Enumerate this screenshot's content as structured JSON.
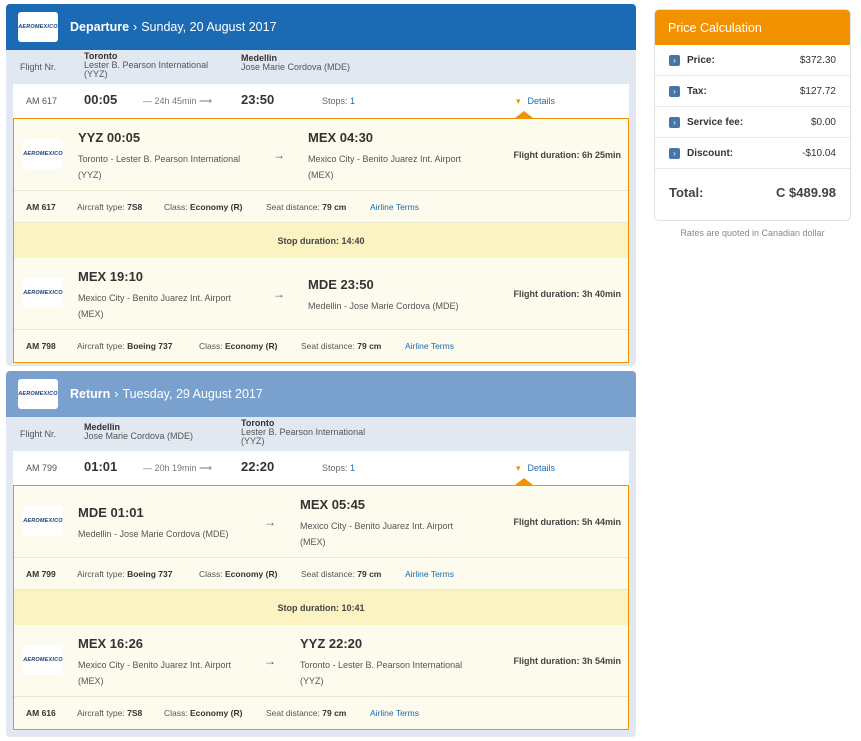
{
  "airline_logo_text": "AEROMEXICO",
  "colors": {
    "departure_header": "#1a6bb3",
    "return_header": "#7aa1cd",
    "accent": "#f29200",
    "link": "#1a6bb3",
    "stop_bar": "#fcf3c3"
  },
  "departure": {
    "header": {
      "label": "Departure",
      "sep": "›",
      "date": "Sunday, 20 August 2017"
    },
    "route": {
      "flight_nr_label": "Flight Nr.",
      "from_city": "Toronto",
      "from_airport": "Lester B. Pearson International",
      "from_code": "(YYZ)",
      "to_city": "Medellin",
      "to_airport": "Jose Marie Cordova (MDE)"
    },
    "summary": {
      "flight": "AM 617",
      "dep_time": "00:05",
      "duration": "— 24h 45min ⟶",
      "arr_time": "23:50",
      "stops_label": "Stops:",
      "stops": "1",
      "details_marker": "▾",
      "details": "Details"
    },
    "segments": [
      {
        "from_code_time": "YYZ 00:05",
        "from_name": "Toronto - Lester B. Pearson International",
        "from_code": "(YYZ)",
        "arrow": "→",
        "to_code_time": "MEX 04:30",
        "to_name": "Mexico City - Benito Juarez Int. Airport",
        "to_code": "(MEX)",
        "duration": "Flight duration: 6h 25min",
        "flight": "AM 617",
        "aircraft_label": "Aircraft type:",
        "aircraft": "7S8",
        "class_label": "Class:",
        "class": "Economy (R)",
        "seat_label": "Seat distance:",
        "seat": "79 cm",
        "terms": "Airline Terms"
      },
      {
        "from_code_time": "MEX 19:10",
        "from_name": "Mexico City - Benito Juarez Int. Airport",
        "from_code": "(MEX)",
        "arrow": "→",
        "to_code_time": "MDE 23:50",
        "to_name": "Medellin - Jose Marie Cordova (MDE)",
        "to_code": "",
        "duration": "Flight duration: 3h 40min",
        "flight": "AM 798",
        "aircraft_label": "Aircraft type:",
        "aircraft": "Boeing 737",
        "class_label": "Class:",
        "class": "Economy (R)",
        "seat_label": "Seat distance:",
        "seat": "79 cm",
        "terms": "Airline Terms"
      }
    ],
    "stop_duration": "Stop duration: 14:40"
  },
  "return": {
    "header": {
      "label": "Return",
      "sep": "›",
      "date": "Tuesday, 29 August 2017"
    },
    "route": {
      "flight_nr_label": "Flight Nr.",
      "from_city": "Medellin",
      "from_airport": "Jose Marie Cordova (MDE)",
      "from_code": "",
      "to_city": "Toronto",
      "to_airport": "Lester B. Pearson International",
      "to_code": "(YYZ)"
    },
    "summary": {
      "flight": "AM 799",
      "dep_time": "01:01",
      "duration": "— 20h 19min ⟶",
      "arr_time": "22:20",
      "stops_label": "Stops:",
      "stops": "1",
      "details_marker": "▾",
      "details": "Details"
    },
    "segments": [
      {
        "from_code_time": "MDE 01:01",
        "from_name": "Medellin - Jose Marie Cordova (MDE)",
        "from_code": "",
        "arrow": "→",
        "to_code_time": "MEX 05:45",
        "to_name": "Mexico City - Benito Juarez Int. Airport",
        "to_code": "(MEX)",
        "duration": "Flight duration: 5h 44min",
        "flight": "AM 799",
        "aircraft_label": "Aircraft type:",
        "aircraft": "Boeing 737",
        "class_label": "Class:",
        "class": "Economy (R)",
        "seat_label": "Seat distance:",
        "seat": "79 cm",
        "terms": "Airline Terms"
      },
      {
        "from_code_time": "MEX 16:26",
        "from_name": "Mexico City - Benito Juarez Int. Airport",
        "from_code": "(MEX)",
        "arrow": "→",
        "to_code_time": "YYZ 22:20",
        "to_name": "Toronto - Lester B. Pearson International",
        "to_code": "(YYZ)",
        "duration": "Flight duration: 3h 54min",
        "flight": "AM 616",
        "aircraft_label": "Aircraft type:",
        "aircraft": "7S8",
        "class_label": "Class:",
        "class": "Economy (R)",
        "seat_label": "Seat distance:",
        "seat": "79 cm",
        "terms": "Airline Terms"
      }
    ],
    "stop_duration": "Stop duration: 10:41"
  },
  "price": {
    "title": "Price Calculation",
    "rows": [
      {
        "label": "Price:",
        "value": "$372.30"
      },
      {
        "label": "Tax:",
        "value": "$127.72"
      },
      {
        "label": "Service fee:",
        "value": "$0.00"
      },
      {
        "label": "Discount:",
        "value": "-$10.04"
      }
    ],
    "row_icon": "›",
    "total_label": "Total:",
    "total_value": "C $489.98",
    "note": "Rates are quoted in Canadian dollar"
  }
}
